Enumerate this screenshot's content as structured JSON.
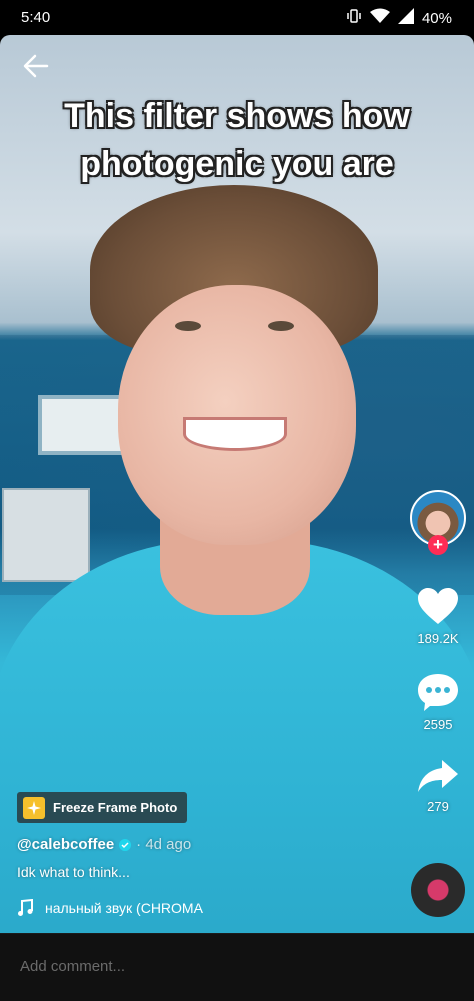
{
  "status_bar": {
    "time": "5:40",
    "battery": "40%"
  },
  "video": {
    "caption_line1": "This filter shows how",
    "caption_line2": "photogenic you are"
  },
  "right_rail": {
    "likes": "189.2K",
    "comments": "2595",
    "shares": "279"
  },
  "effect": {
    "label": "Freeze Frame Photo"
  },
  "post": {
    "username": "@calebcoffee",
    "time_ago": "· 4d ago",
    "description": "Idk what to think...",
    "music": "нальный звук (CHROMA"
  },
  "comment_bar": {
    "placeholder": "Add comment..."
  },
  "colors": {
    "accent": "#fe2c55",
    "verified": "#20d5ec",
    "effect_icon": "#f6c02c"
  },
  "icons": [
    "arrow-left-icon",
    "heart-icon",
    "comment-icon",
    "share-icon",
    "music-note-icon",
    "sparkle-icon",
    "verified-icon",
    "plus-icon"
  ]
}
